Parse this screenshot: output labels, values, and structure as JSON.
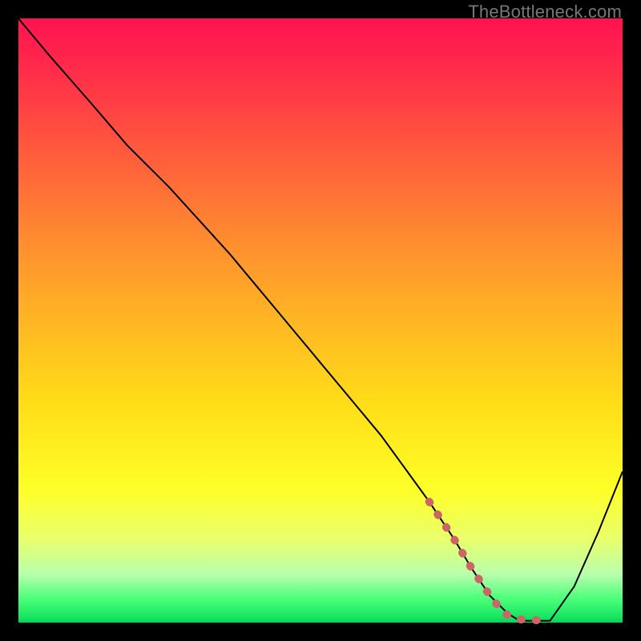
{
  "watermark": "TheBottleneck.com",
  "chart_data": {
    "type": "line",
    "title": "",
    "xlabel": "",
    "ylabel": "",
    "xlim": [
      0,
      100
    ],
    "ylim": [
      0,
      100
    ],
    "grid": false,
    "legend": false,
    "series": [
      {
        "name": "bottleneck-curve",
        "color": "#000000",
        "stroke_width": 2,
        "x": [
          0,
          5,
          12,
          18,
          20,
          25,
          30,
          35,
          40,
          45,
          50,
          55,
          60,
          64,
          68,
          72,
          75,
          78,
          81,
          82.5,
          84,
          86,
          88,
          92,
          96,
          100
        ],
        "y": [
          100,
          94,
          86,
          79,
          77,
          72,
          66.5,
          61,
          55,
          49,
          43,
          37,
          31,
          25.5,
          20,
          14,
          9,
          4.5,
          1.5,
          0.6,
          0.3,
          0.3,
          0.3,
          6,
          15,
          25
        ]
      },
      {
        "name": "optimal-range-marker",
        "color": "#cc6666",
        "stroke_width": 10,
        "linecap": "round",
        "dash": "1 18",
        "x": [
          68,
          72,
          75,
          78,
          80,
          81,
          82,
          84,
          86,
          88
        ],
        "y": [
          20,
          14,
          9,
          4.5,
          2,
          1.2,
          0.7,
          0.4,
          0.4,
          0.4
        ]
      }
    ]
  }
}
